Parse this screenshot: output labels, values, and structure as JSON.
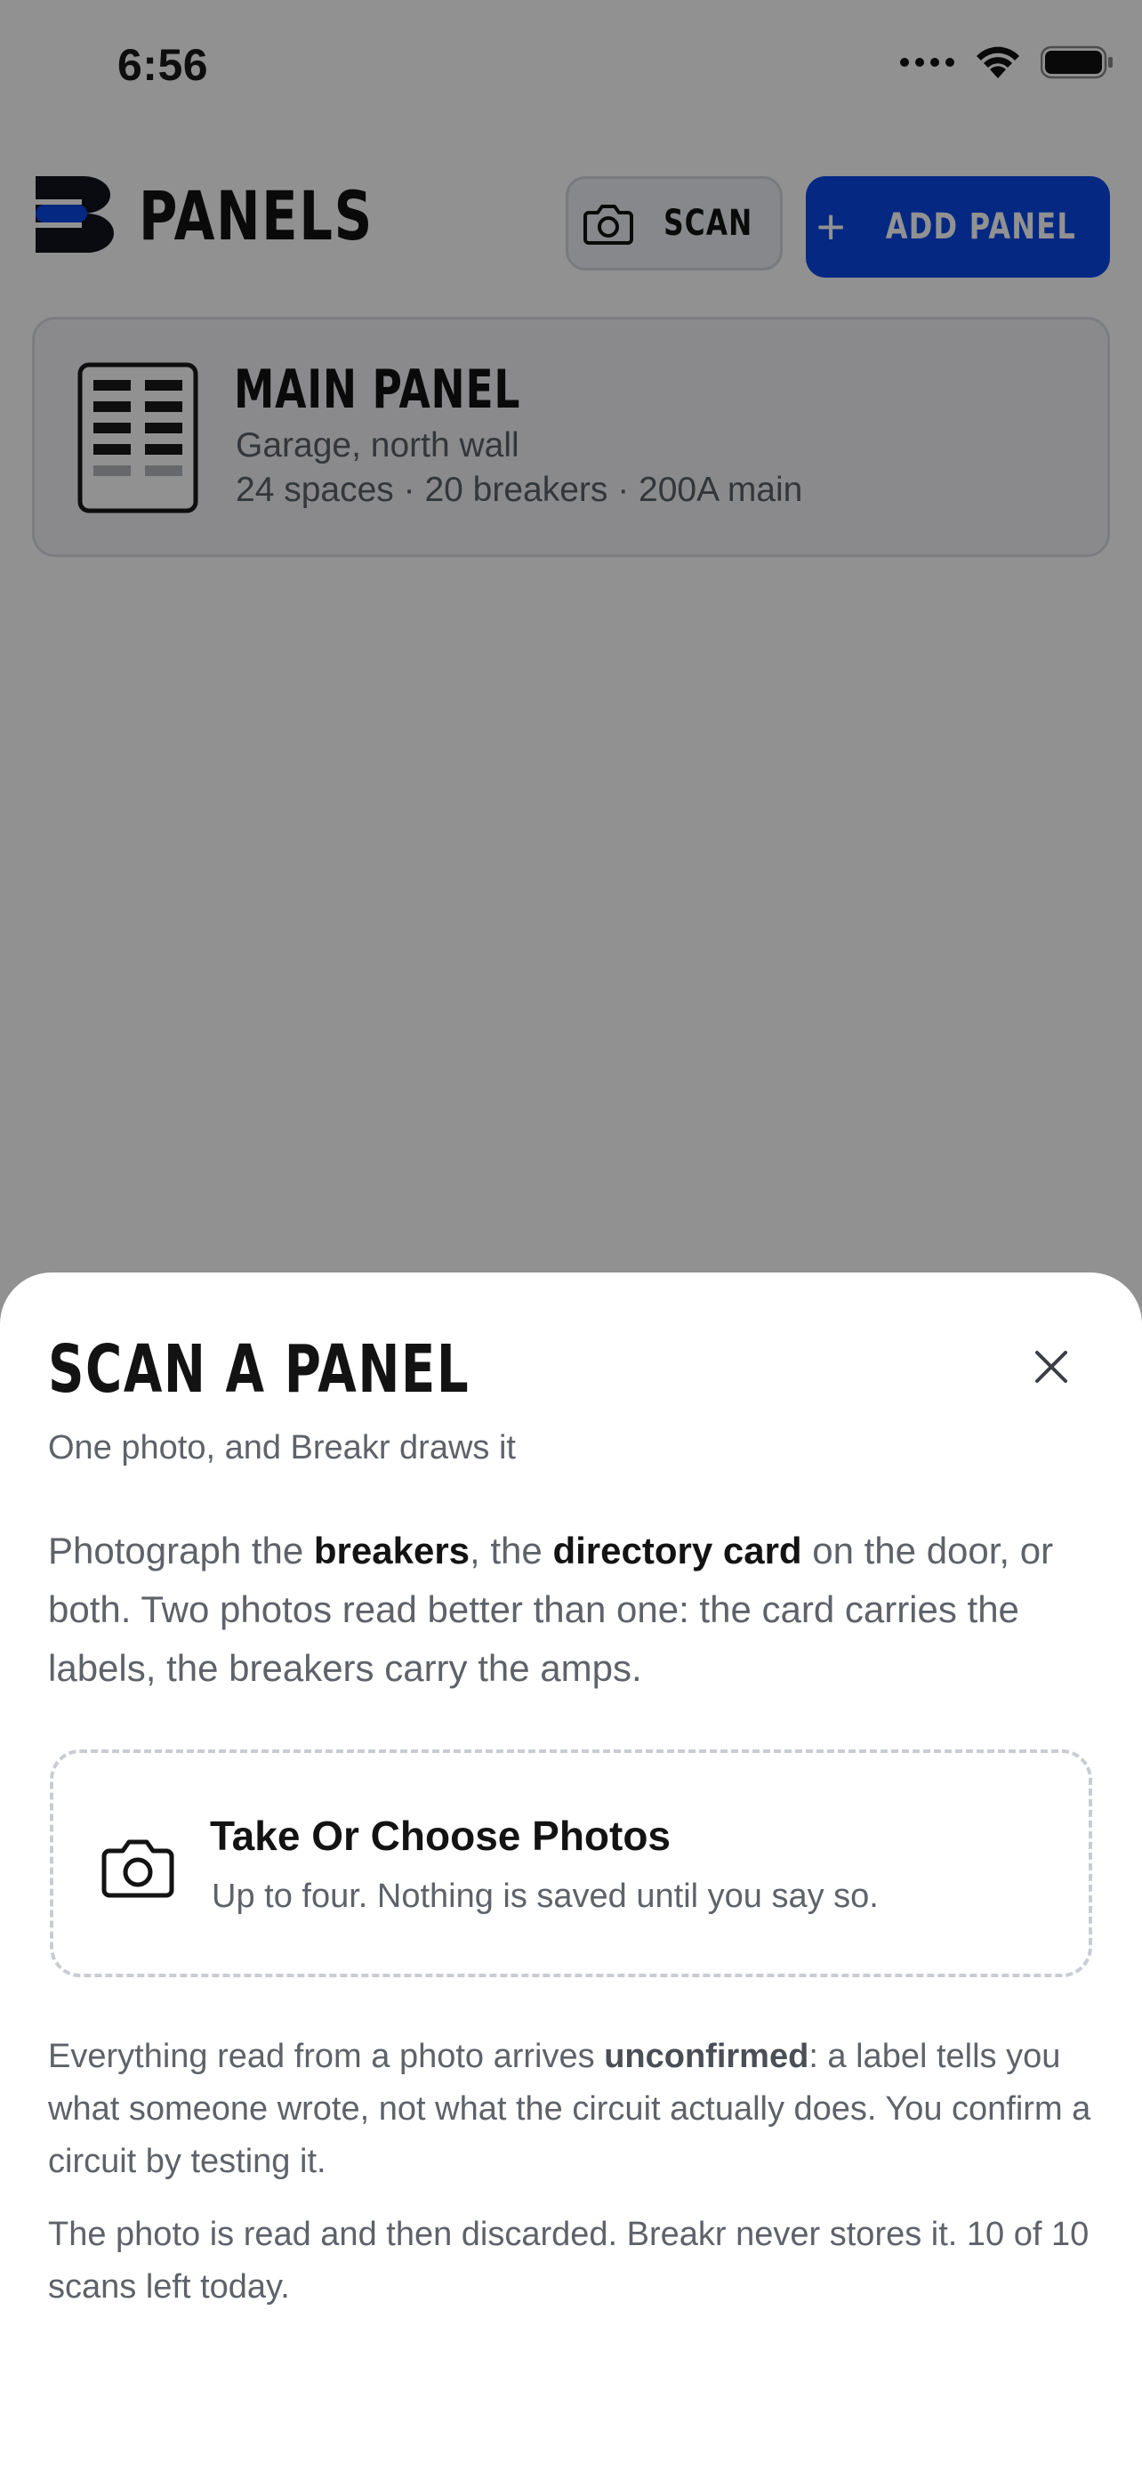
{
  "status_bar": {
    "time": "6:56"
  },
  "header": {
    "title": "PANELS",
    "scan_label": "SCAN",
    "add_label": "ADD PANEL"
  },
  "panels": [
    {
      "name": "MAIN PANEL",
      "location": "Garage, north wall",
      "meta": "24 spaces · 20 breakers · 200A main"
    }
  ],
  "scan_sheet": {
    "title": "SCAN A PANEL",
    "subtitle": "One photo, and Breakr draws it",
    "intro": {
      "p1": "Photograph the ",
      "b1": "breakers",
      "p2": ", the ",
      "b2": "directory card",
      "p3": " on the door, or both. Two photos read better than one: the card carries the labels, the breakers carry the amps."
    },
    "picker": {
      "title": "Take Or Choose Photos",
      "subtitle": "Up to four. Nothing is saved until you say so."
    },
    "note1": {
      "p1": "Everything read from a photo arrives ",
      "b1": "unconfirmed",
      "p2": ": a label tells you what someone wrote, not what the circuit actually does. You confirm a circuit by testing it."
    },
    "note2": "The photo is read and then discarded. Breakr never stores it. 10 of 10 scans left today."
  },
  "colors": {
    "accent": "#0a47e6",
    "text_primary": "#131313",
    "text_secondary": "#5e6269",
    "scrim": "rgba(0,0,0,0.43)"
  },
  "icons": [
    "wifi-icon",
    "battery-icon",
    "signal-icon",
    "camera-icon",
    "plus-icon",
    "panel-icon",
    "close-icon",
    "logo"
  ]
}
